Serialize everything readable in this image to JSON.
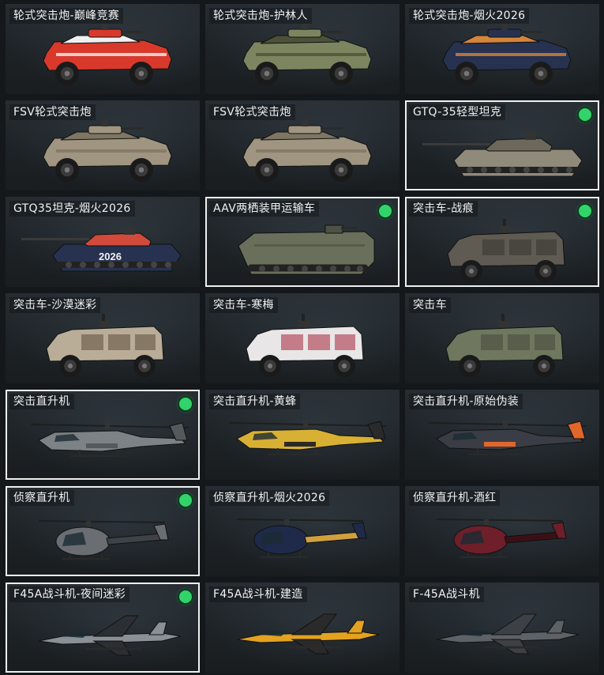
{
  "vehicles": [
    {
      "label": "轮式突击炮-巅峰竞赛",
      "selected": false,
      "equipped": false,
      "kind": "wheeled-gun",
      "color": "#d8392b",
      "accent": "#f0f0f0"
    },
    {
      "label": "轮式突击炮-护林人",
      "selected": false,
      "equipped": false,
      "kind": "wheeled-gun",
      "color": "#7d8560",
      "accent": "#4b5238"
    },
    {
      "label": "轮式突击炮-烟火2026",
      "selected": false,
      "equipped": false,
      "kind": "wheeled-gun",
      "color": "#263250",
      "accent": "#d4843b"
    },
    {
      "label": "FSV轮式突击炮",
      "selected": false,
      "equipped": false,
      "kind": "wheeled-gun",
      "color": "#a09580",
      "accent": "#7e7563"
    },
    {
      "label": "FSV轮式突击炮",
      "selected": false,
      "equipped": false,
      "kind": "wheeled-gun",
      "color": "#a09580",
      "accent": "#7e7563"
    },
    {
      "label": "GTQ-35轻型坦克",
      "selected": true,
      "equipped": true,
      "kind": "tank",
      "color": "#8f8a7a",
      "accent": "#6c685c"
    },
    {
      "label": "GTQ35坦克-烟火2026",
      "selected": false,
      "equipped": false,
      "kind": "tank",
      "color": "#263250",
      "accent": "#d24a3a",
      "decal": "2026"
    },
    {
      "label": "AAV两栖装甲运输车",
      "selected": true,
      "equipped": true,
      "kind": "amphibious",
      "color": "#6a6f5b",
      "accent": "#4e5244"
    },
    {
      "label": "突击车-战痕",
      "selected": true,
      "equipped": true,
      "kind": "assault-car",
      "color": "#5f5a52",
      "accent": "#3d3a35"
    },
    {
      "label": "突击车-沙漠迷彩",
      "selected": false,
      "equipped": false,
      "kind": "assault-car",
      "color": "#b9ad98",
      "accent": "#6b5c4a"
    },
    {
      "label": "突击车-寒梅",
      "selected": false,
      "equipped": false,
      "kind": "assault-car",
      "color": "#e8e6e6",
      "accent": "#b04356"
    },
    {
      "label": "突击车",
      "selected": false,
      "equipped": false,
      "kind": "assault-car",
      "color": "#6f775f",
      "accent": "#4b5140"
    },
    {
      "label": "突击直升机",
      "selected": true,
      "equipped": true,
      "kind": "attack-heli",
      "color": "#7d8286",
      "accent": "#55595c"
    },
    {
      "label": "突击直升机-黄蜂",
      "selected": false,
      "equipped": false,
      "kind": "attack-heli",
      "color": "#d8b033",
      "accent": "#2a2a2a"
    },
    {
      "label": "突击直升机-原始伪装",
      "selected": false,
      "equipped": false,
      "kind": "attack-heli",
      "color": "#3a3d45",
      "accent": "#e0662a"
    },
    {
      "label": "侦察直升机",
      "selected": true,
      "equipped": true,
      "kind": "scout-heli",
      "color": "#6a6e72",
      "accent": "#3e4246"
    },
    {
      "label": "侦察直升机-烟火2026",
      "selected": false,
      "equipped": false,
      "kind": "scout-heli",
      "color": "#1f2a4a",
      "accent": "#d0a040"
    },
    {
      "label": "侦察直升机-酒红",
      "selected": false,
      "equipped": false,
      "kind": "scout-heli",
      "color": "#6e1f2a",
      "accent": "#3a1016"
    },
    {
      "label": "F45A战斗机-夜间迷彩",
      "selected": true,
      "equipped": true,
      "kind": "jet",
      "color": "#8b9096",
      "accent": "#2b2f33"
    },
    {
      "label": "F45A战斗机-建造",
      "selected": false,
      "equipped": false,
      "kind": "jet",
      "color": "#e3a21f",
      "accent": "#2a2a2a"
    },
    {
      "label": "F-45A战斗机",
      "selected": false,
      "equipped": false,
      "kind": "jet",
      "color": "#5e6266",
      "accent": "#3d4044"
    }
  ]
}
